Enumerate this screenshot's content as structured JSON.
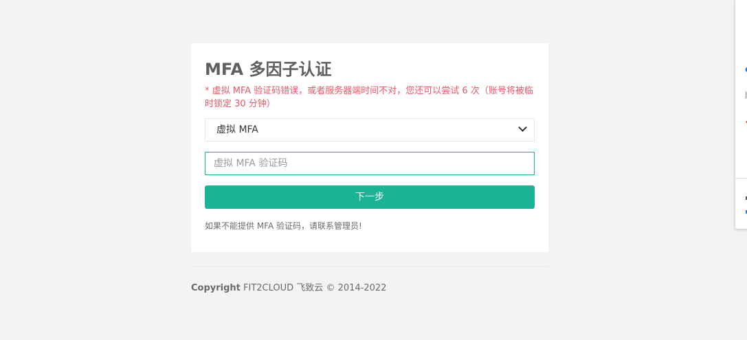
{
  "mfa": {
    "title": "MFA 多因子认证",
    "error_message": "* 虚拟 MFA 验证码错误，或者服务器端时间不对，您还可以尝试 6 次（账号将被临时锁定 30 分钟）",
    "select_value": "虚拟 MFA",
    "code_placeholder": "虚拟 MFA 验证码",
    "next_button": "下一步",
    "help_text": "如果不能提供 MFA 验证码，请联系管理员!"
  },
  "footer": {
    "copyright_label": "Copyright",
    "copyright_text": " FIT2CLOUD 飞致云 © 2014-2022"
  },
  "colors": {
    "accent": "#1ab394",
    "error": "#ed5565",
    "background": "#f3f3f4"
  }
}
